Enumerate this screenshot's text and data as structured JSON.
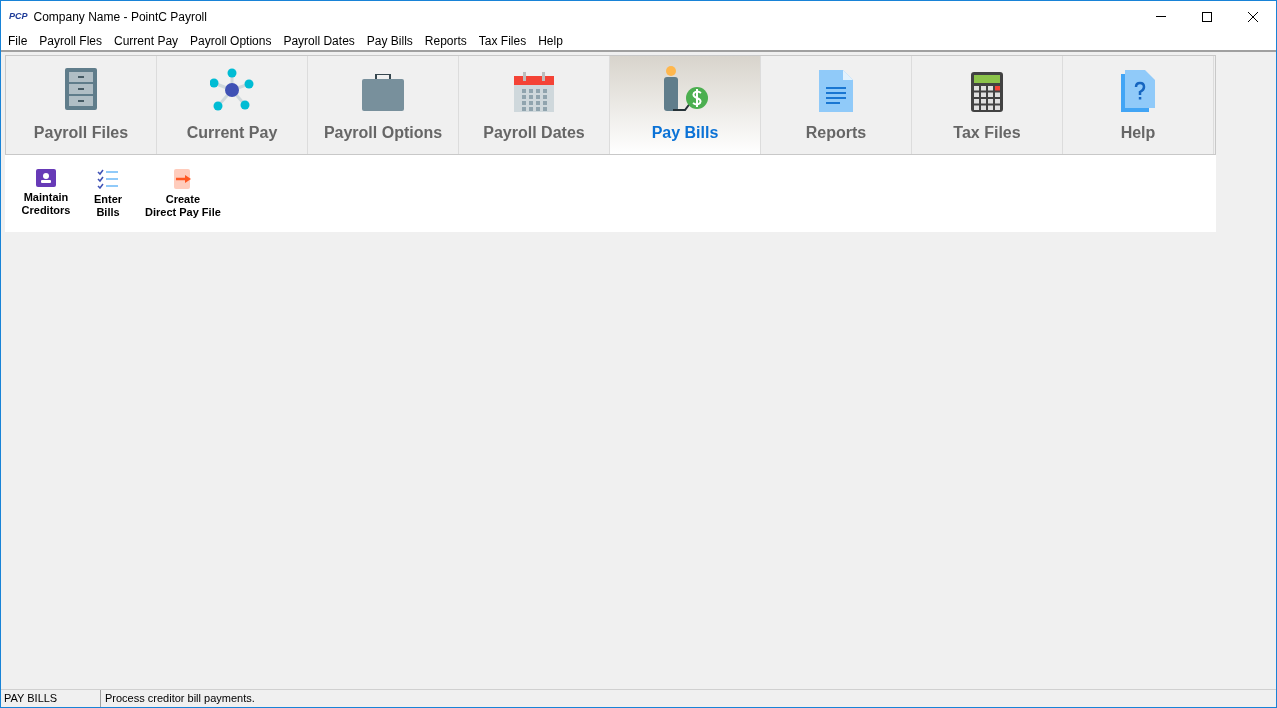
{
  "window": {
    "logo": "PCP",
    "title": "Company Name - PointC Payroll"
  },
  "menu": [
    "File",
    "Payroll Fles",
    "Current Pay",
    "Payroll Options",
    "Payroll Dates",
    "Pay Bills",
    "Reports",
    "Tax Files",
    "Help"
  ],
  "tabs": [
    {
      "label": "Payroll Files",
      "selected": false
    },
    {
      "label": "Current Pay",
      "selected": false
    },
    {
      "label": "Payroll Options",
      "selected": false
    },
    {
      "label": "Payroll Dates",
      "selected": false
    },
    {
      "label": "Pay Bills",
      "selected": true
    },
    {
      "label": "Reports",
      "selected": false
    },
    {
      "label": "Tax Files",
      "selected": false
    },
    {
      "label": "Help",
      "selected": false
    }
  ],
  "actions": [
    {
      "lines": [
        "Maintain",
        "Creditors"
      ]
    },
    {
      "lines": [
        "Enter",
        "Bills"
      ]
    },
    {
      "lines": [
        "Create",
        "Direct Pay File"
      ]
    }
  ],
  "status_bar": {
    "section": "PAY BILLS",
    "message": "Process creditor bill payments."
  }
}
